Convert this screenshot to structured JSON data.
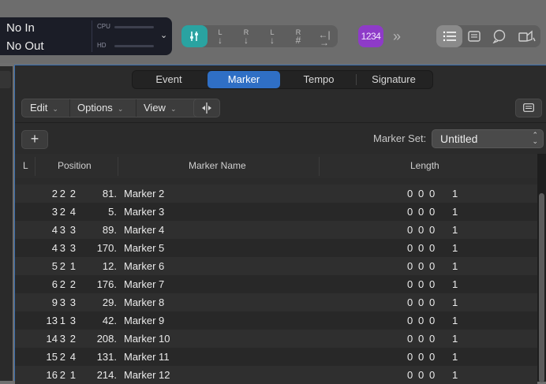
{
  "lcd": {
    "input": "No In",
    "output": "No Out",
    "cpu_label": "CPU",
    "hd_label": "HD"
  },
  "toolbar": {
    "tools": [
      {
        "top": "L",
        "name": "left-locator-down"
      },
      {
        "top": "R",
        "name": "right-locator-down"
      },
      {
        "top": "L",
        "sub": "#",
        "name": "left-locator-sharp"
      },
      {
        "top": "R",
        "sub": "#",
        "name": "right-locator-sharp"
      }
    ],
    "count_in": "1234"
  },
  "editor": {
    "tabs": [
      "Event",
      "Marker",
      "Tempo",
      "Signature"
    ],
    "active_tab": "Marker",
    "menus": [
      "Edit",
      "Options",
      "View"
    ],
    "marker_set_label": "Marker Set:",
    "marker_set_value": "Untitled",
    "columns": {
      "lock": "L",
      "position": "Position",
      "name": "Marker Name",
      "length": "Length"
    },
    "rows": [
      {
        "pos": [
          "2",
          "2",
          "2",
          "81."
        ],
        "name": "Marker 2",
        "len": [
          "0",
          "0",
          "0",
          "1"
        ]
      },
      {
        "pos": [
          "3",
          "2",
          "4",
          "5."
        ],
        "name": "Marker 3",
        "len": [
          "0",
          "0",
          "0",
          "1"
        ]
      },
      {
        "pos": [
          "4",
          "3",
          "3",
          "89."
        ],
        "name": "Marker 4",
        "len": [
          "0",
          "0",
          "0",
          "1"
        ]
      },
      {
        "pos": [
          "4",
          "3",
          "3",
          "170."
        ],
        "name": "Marker 5",
        "len": [
          "0",
          "0",
          "0",
          "1"
        ]
      },
      {
        "pos": [
          "5",
          "2",
          "1",
          "12."
        ],
        "name": "Marker 6",
        "len": [
          "0",
          "0",
          "0",
          "1"
        ]
      },
      {
        "pos": [
          "6",
          "2",
          "2",
          "176."
        ],
        "name": "Marker 7",
        "len": [
          "0",
          "0",
          "0",
          "1"
        ]
      },
      {
        "pos": [
          "9",
          "3",
          "3",
          "29."
        ],
        "name": "Marker 8",
        "len": [
          "0",
          "0",
          "0",
          "1"
        ]
      },
      {
        "pos": [
          "13",
          "1",
          "3",
          "42."
        ],
        "name": "Marker 9",
        "len": [
          "0",
          "0",
          "0",
          "1"
        ]
      },
      {
        "pos": [
          "14",
          "3",
          "2",
          "208."
        ],
        "name": "Marker 10",
        "len": [
          "0",
          "0",
          "0",
          "1"
        ]
      },
      {
        "pos": [
          "15",
          "2",
          "4",
          "131."
        ],
        "name": "Marker 11",
        "len": [
          "0",
          "0",
          "0",
          "1"
        ]
      },
      {
        "pos": [
          "16",
          "2",
          "1",
          "214."
        ],
        "name": "Marker 12",
        "len": [
          "0",
          "0",
          "0",
          "1"
        ]
      }
    ]
  },
  "colors": {
    "accent": "#2f6fc5",
    "teal": "#2aa3a1",
    "purple": "#8e3bc8"
  }
}
